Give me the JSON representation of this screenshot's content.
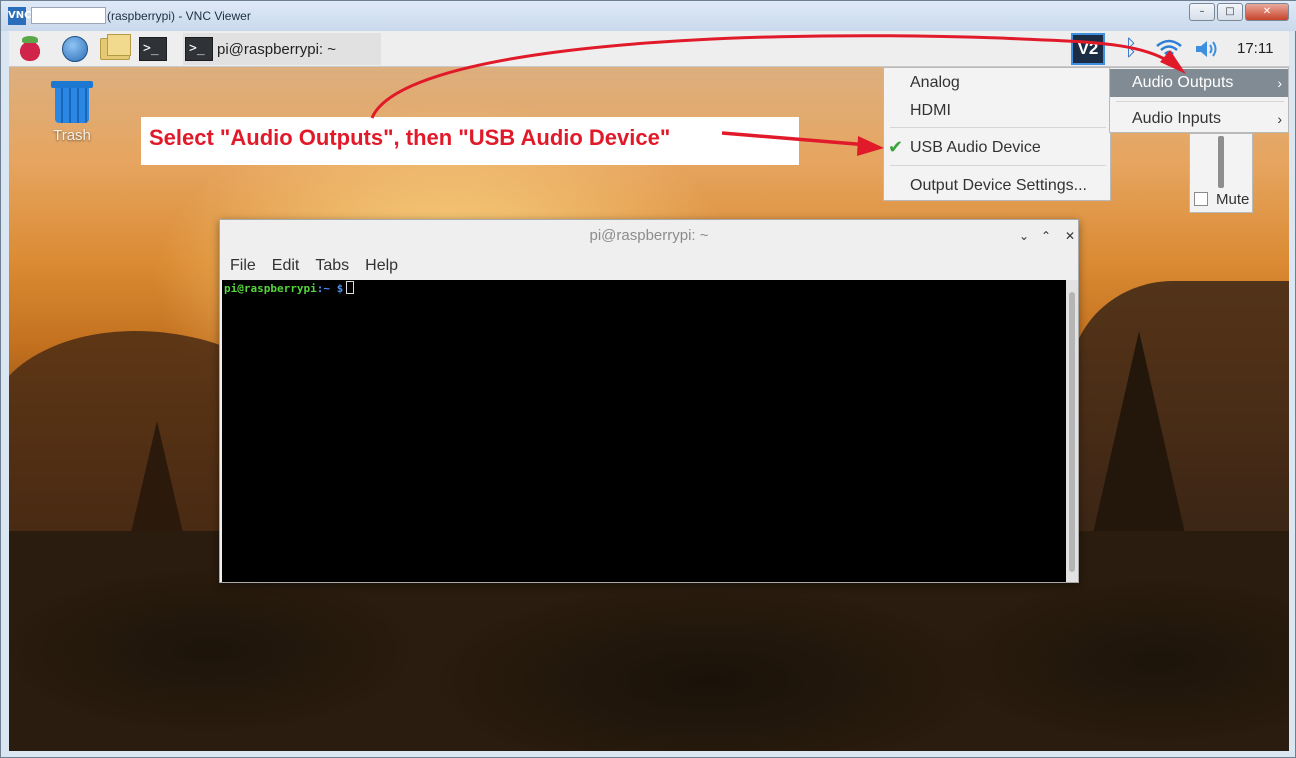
{
  "viewer": {
    "title": "(raspberrypi) - VNC Viewer",
    "logo": "VNC",
    "minimize": "–",
    "maximize": "□",
    "close": "✕"
  },
  "taskbar": {
    "task_window_label": "pi@raspberrypi: ~",
    "term_prompt_glyph": ">_",
    "tray_vnc": "V2",
    "bluetooth_glyph": "ᛒ",
    "clock": "17:11"
  },
  "desktop": {
    "trash_label": "Trash"
  },
  "callout": {
    "text": "Select \"Audio Outputs\", then \"USB Audio Device\""
  },
  "audio_menu": {
    "items": [
      "Analog",
      "HDMI",
      "USB Audio Device",
      "Output Device Settings..."
    ],
    "checked_item": "USB Audio Device",
    "check_glyph": "✔"
  },
  "audio_submenu": {
    "items": [
      "Audio Outputs",
      "Audio Inputs"
    ],
    "highlighted": "Audio Outputs",
    "arrow": "›"
  },
  "volume": {
    "mute_label": "Mute",
    "muted": false
  },
  "terminal": {
    "title": "pi@raspberrypi: ~",
    "menus": [
      "File",
      "Edit",
      "Tabs",
      "Help"
    ],
    "prompt_user": "pi@raspberrypi",
    "prompt_path": ":~ $",
    "minimize_glyph": "⌄",
    "maximize_glyph": "⌃",
    "close_glyph": "✕"
  },
  "colors": {
    "annotation_red": "#e11a2a",
    "menu_highlight": "#818b94",
    "check_green": "#3aa33a"
  }
}
